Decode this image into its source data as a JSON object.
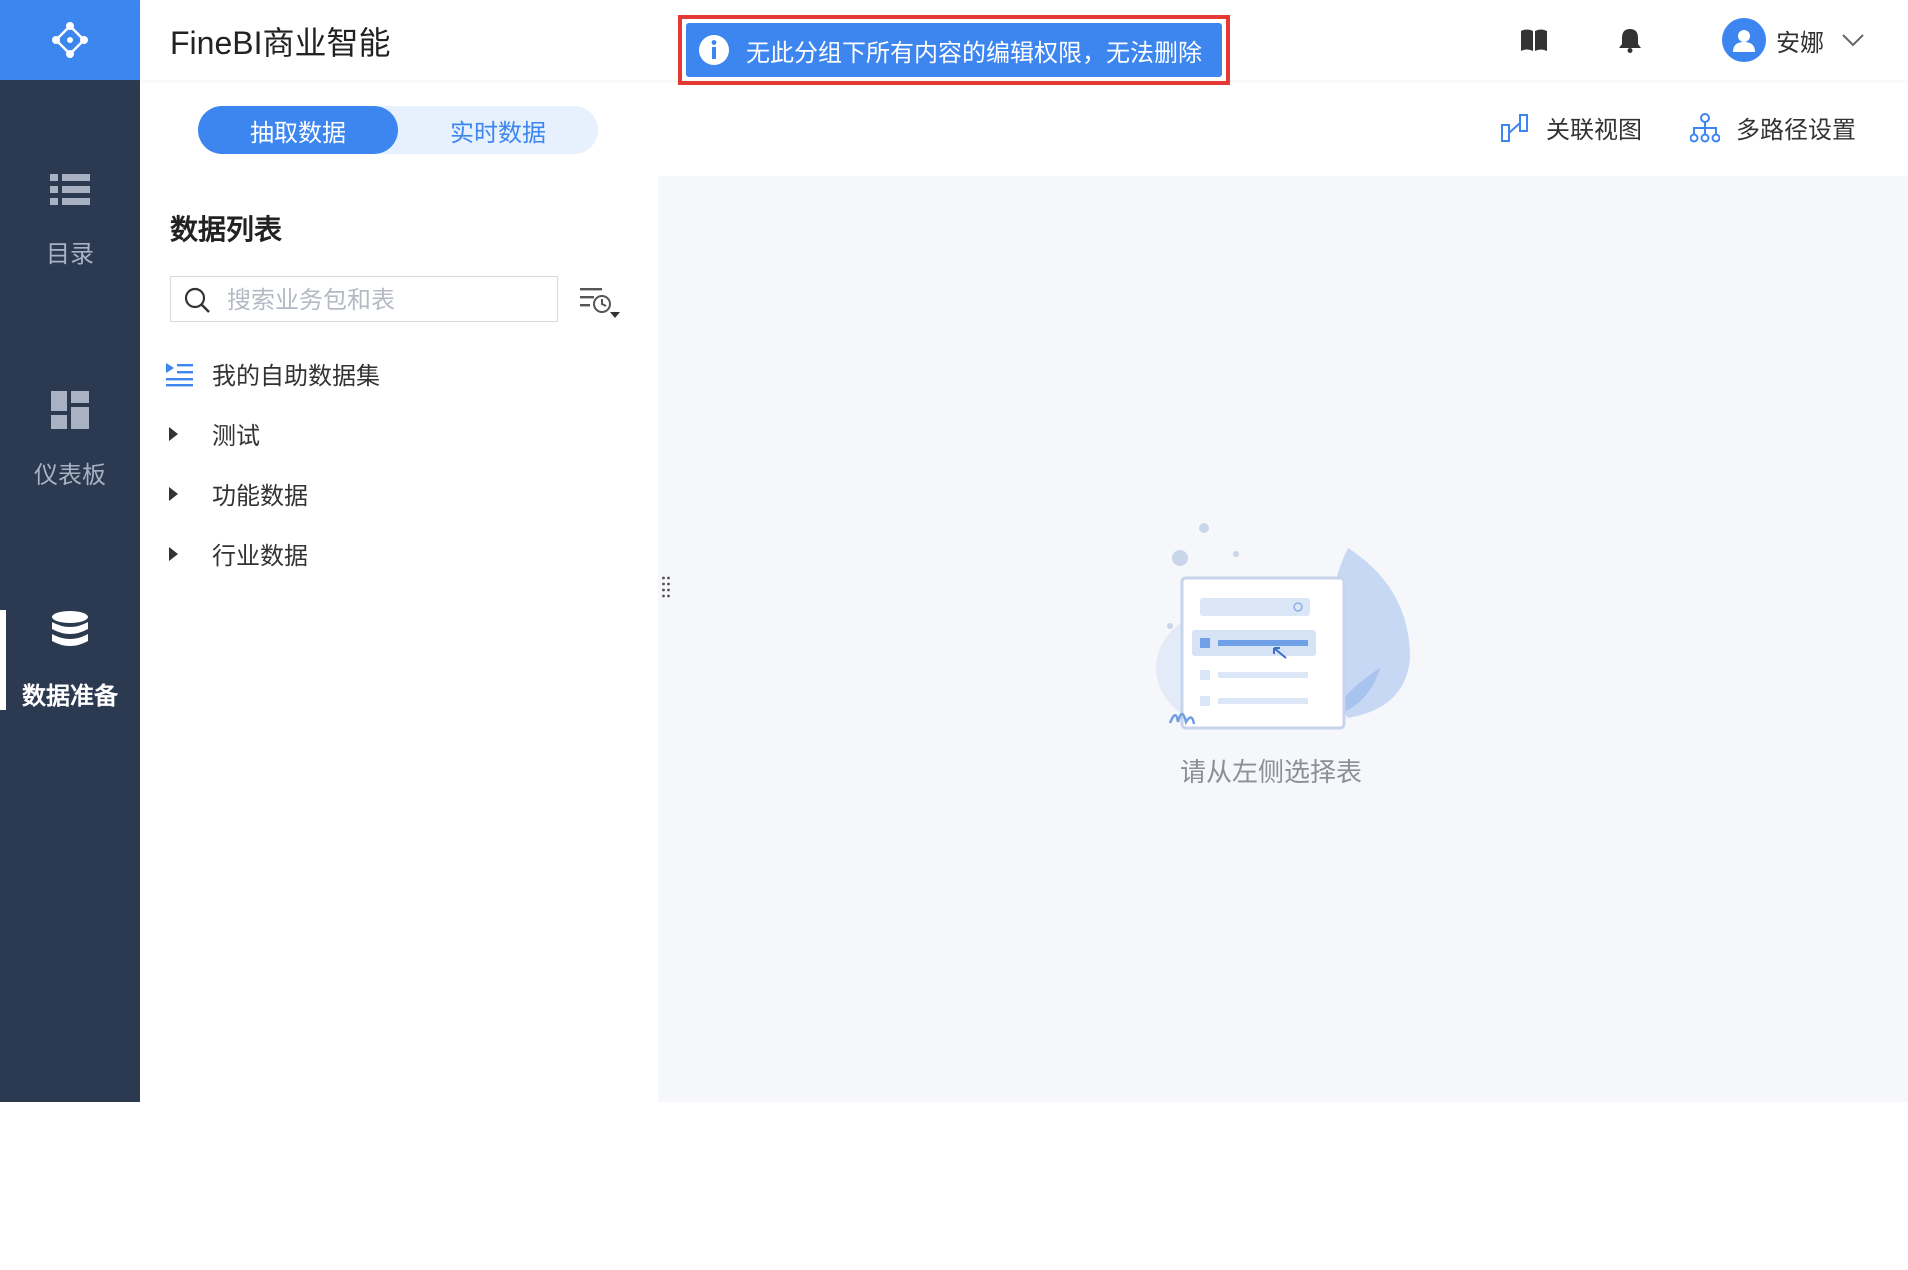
{
  "app": {
    "title": "FineBI商业智能"
  },
  "sidebar": {
    "items": [
      {
        "label": "目录",
        "icon": "list-icon"
      },
      {
        "label": "仪表板",
        "icon": "dashboard-icon"
      },
      {
        "label": "数据准备",
        "icon": "database-icon",
        "active": true
      }
    ]
  },
  "header": {
    "user_name": "安娜",
    "icons": [
      "book-icon",
      "bell-icon",
      "avatar-icon",
      "chevron-down-icon"
    ]
  },
  "toast": {
    "message": "无此分组下所有内容的编辑权限，无法删除"
  },
  "tabs": [
    {
      "label": "抽取数据",
      "active": true
    },
    {
      "label": "实时数据",
      "active": false
    }
  ],
  "toolbar": {
    "relation_view": "关联视图",
    "multipath_settings": "多路径设置"
  },
  "panel": {
    "title": "数据列表",
    "search_placeholder": "搜索业务包和表",
    "items": [
      {
        "label": "我的自助数据集",
        "icon": "dataset-list-icon"
      },
      {
        "label": "测试",
        "icon": "caret-right-icon"
      },
      {
        "label": "功能数据",
        "icon": "caret-right-icon"
      },
      {
        "label": "行业数据",
        "icon": "caret-right-icon"
      }
    ]
  },
  "main": {
    "empty_hint": "请从左侧选择表"
  },
  "colors": {
    "accent": "#3d86f0",
    "sidebar_bg": "#2c3a51",
    "highlight_border": "#e53935",
    "content_bg": "#f5f7fa"
  }
}
